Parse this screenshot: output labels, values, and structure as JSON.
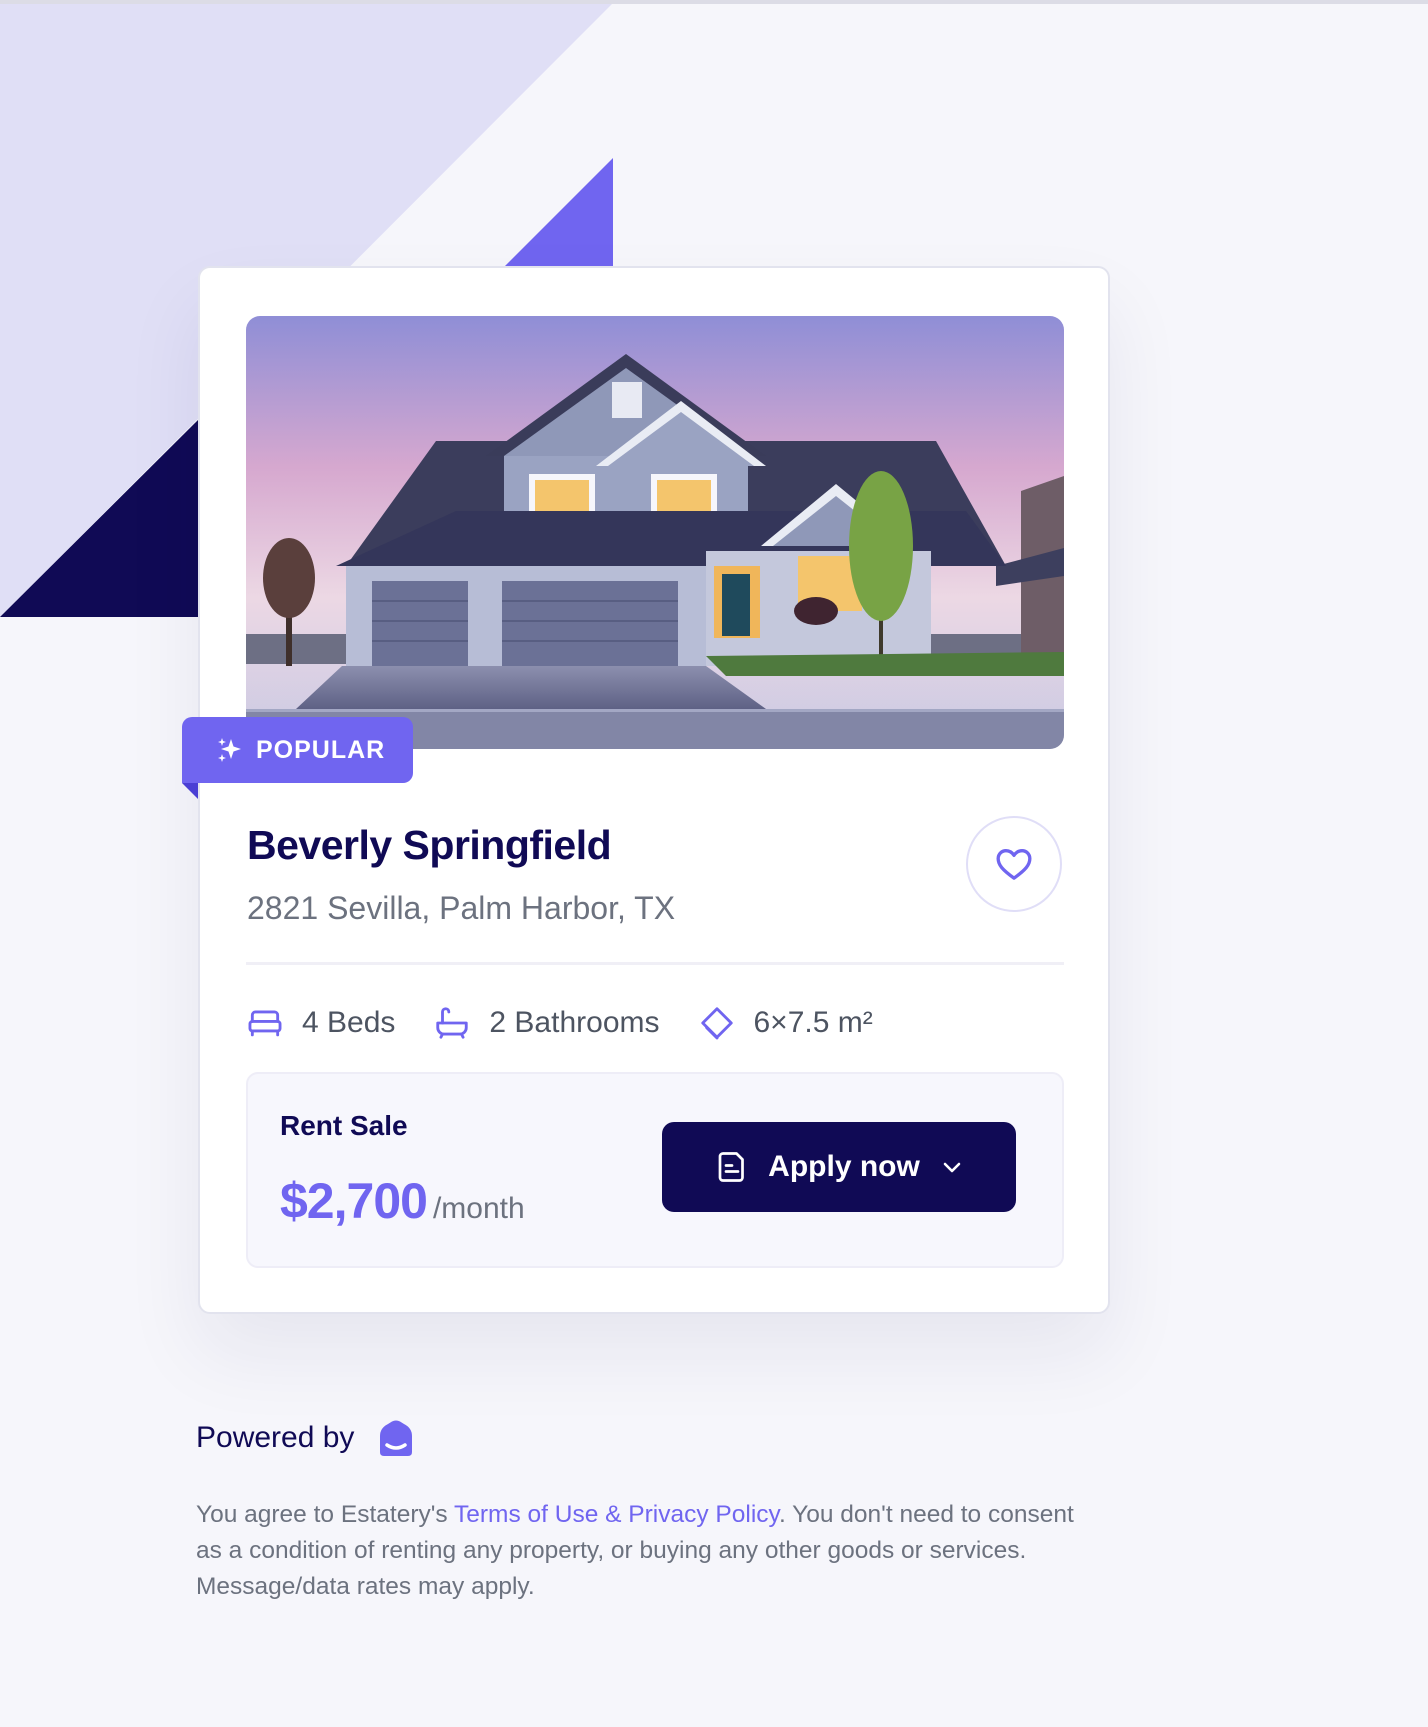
{
  "colors": {
    "brand": "#7065f0",
    "navy": "#100a55",
    "background": "#f6f6fb",
    "muted_text": "#6c727f"
  },
  "listing": {
    "badge": "POPULAR",
    "title": "Beverly Springfield",
    "address": "2821 Sevilla, Palm Harbor, TX",
    "favorite_icon": "heart-icon",
    "features": [
      {
        "icon": "bed-icon",
        "label": "4 Beds"
      },
      {
        "icon": "bath-icon",
        "label": "2 Bathrooms"
      },
      {
        "icon": "area-icon",
        "label": "6×7.5 m²"
      }
    ],
    "rent_label": "Rent Sale",
    "price": "$2,700",
    "price_unit": "/month",
    "apply_label": "Apply now"
  },
  "footer": {
    "powered_by": "Powered by",
    "legal_prefix": "You agree to Estatery's ",
    "legal_link": "Terms of Use & Privacy Policy",
    "legal_suffix": ". You don't need to consent as a condition of renting any property, or buying any other goods or services. Message/data rates may apply."
  }
}
